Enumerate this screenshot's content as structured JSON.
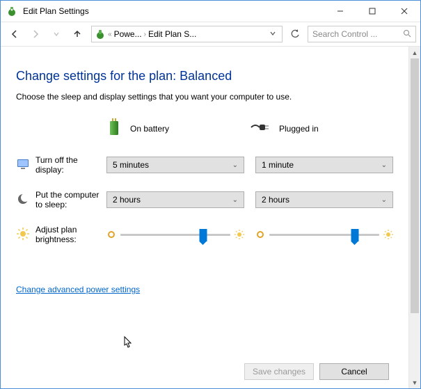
{
  "window": {
    "title": "Edit Plan Settings"
  },
  "breadcrumb": {
    "items": [
      "Powe...",
      "Edit Plan S..."
    ]
  },
  "search": {
    "placeholder": "Search Control ..."
  },
  "heading": "Change settings for the plan: Balanced",
  "subtext": "Choose the sleep and display settings that you want your computer to use.",
  "columns": {
    "battery": "On battery",
    "plugged": "Plugged in"
  },
  "rows": {
    "display": {
      "label": "Turn off the display:",
      "battery_value": "5 minutes",
      "plugged_value": "1 minute"
    },
    "sleep": {
      "label": "Put the computer to sleep:",
      "battery_value": "2 hours",
      "plugged_value": "2 hours"
    },
    "brightness": {
      "label": "Adjust plan brightness:",
      "battery_percent": 75,
      "plugged_percent": 78
    }
  },
  "link": "Change advanced power settings",
  "buttons": {
    "save": "Save changes",
    "cancel": "Cancel"
  }
}
